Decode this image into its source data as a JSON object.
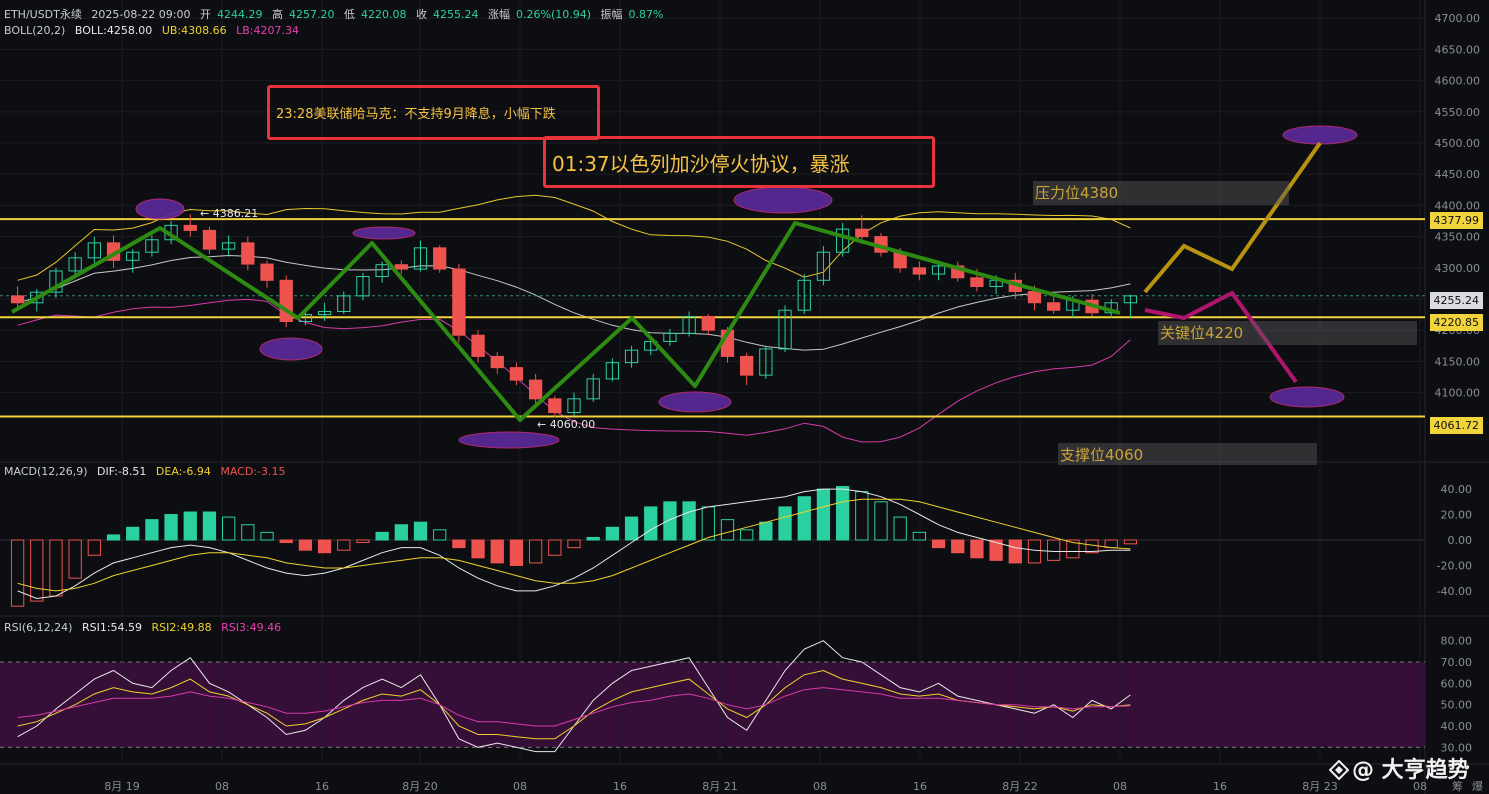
{
  "header": {
    "symbol": "ETH/USDT永续",
    "datetime": "2025-08-22 09:00",
    "open_label": "开",
    "open": "4244.29",
    "high_label": "高",
    "high": "4257.20",
    "low_label": "低",
    "low": "4220.08",
    "close_label": "收",
    "close": "4255.24",
    "chg_label": "涨幅",
    "chg": "0.26%(10.94)",
    "amp_label": "振幅",
    "amp": "0.87%"
  },
  "boll": {
    "name": "BOLL(20,2)",
    "boll": "BOLL:4258.00",
    "ub": "UB:4308.66",
    "lb": "LB:4207.34"
  },
  "macd": {
    "name": "MACD(12,26,9)",
    "dif": "DIF:-8.51",
    "dea": "DEA:-6.94",
    "macd": "MACD:-3.15"
  },
  "rsi": {
    "name": "RSI(6,12,24)",
    "rsi1": "RSI1:54.59",
    "rsi2": "RSI2:49.88",
    "rsi3": "RSI3:49.46"
  },
  "annotations": {
    "note1": "23:28美联储哈马克：不支持9月降息，小幅下跌",
    "note2": "01:37以色列加沙停火协议，暴涨"
  },
  "levels": {
    "resistance": "压力位4380",
    "key": "关键位4220",
    "support": "支撑位4060"
  },
  "price_tags": {
    "upper": "4377.99",
    "current": "4255.24",
    "key": "4220.85",
    "lower": "4061.72"
  },
  "point_labels": {
    "high": "← 4386.21",
    "low": "← 4060.00"
  },
  "watermark": "@ 大亨趋势",
  "corner_labels": [
    "筹",
    "爆"
  ],
  "colors": {
    "up": "#2bd0a0",
    "down": "#ef5350",
    "level": "#f1d33b",
    "trend": "#2e8b12",
    "bull": "#b8930f",
    "bear": "#b0156e",
    "ellipse": "#5b2a9c"
  },
  "chart_data": [
    {
      "type": "candlestick",
      "title": "ETH/USDT永续",
      "ylim": [
        4000,
        4710
      ],
      "y_ticks": [
        4700,
        4650,
        4600,
        4550,
        4500,
        4450,
        4400,
        4350,
        4300,
        4250,
        4200,
        4150,
        4100
      ],
      "x_ticks": [
        "8月 19",
        "08",
        "16",
        "8月 20",
        "08",
        "16",
        "8月 21",
        "08",
        "16",
        "8月 22",
        "08",
        "16",
        "8月 23",
        "08"
      ],
      "levels": [
        4377.99,
        4220.85,
        4061.72
      ],
      "high_marker": 4386.21,
      "low_marker": 4060.0,
      "candles": [
        [
          4255,
          4270,
          4232,
          4244
        ],
        [
          4244,
          4266,
          4230,
          4261
        ],
        [
          4261,
          4300,
          4252,
          4295
        ],
        [
          4295,
          4325,
          4285,
          4316
        ],
        [
          4316,
          4350,
          4308,
          4340
        ],
        [
          4340,
          4352,
          4300,
          4312
        ],
        [
          4312,
          4330,
          4292,
          4325
        ],
        [
          4325,
          4352,
          4318,
          4345
        ],
        [
          4345,
          4375,
          4338,
          4368
        ],
        [
          4368,
          4386,
          4350,
          4360
        ],
        [
          4360,
          4366,
          4322,
          4330
        ],
        [
          4330,
          4352,
          4318,
          4340
        ],
        [
          4340,
          4350,
          4296,
          4306
        ],
        [
          4306,
          4312,
          4268,
          4280
        ],
        [
          4280,
          4288,
          4205,
          4214
        ],
        [
          4214,
          4230,
          4208,
          4225
        ],
        [
          4225,
          4244,
          4215,
          4230
        ],
        [
          4230,
          4262,
          4226,
          4255
        ],
        [
          4255,
          4292,
          4248,
          4286
        ],
        [
          4286,
          4310,
          4276,
          4305
        ],
        [
          4305,
          4312,
          4290,
          4298
        ],
        [
          4298,
          4344,
          4294,
          4332
        ],
        [
          4332,
          4336,
          4292,
          4298
        ],
        [
          4298,
          4306,
          4180,
          4192
        ],
        [
          4192,
          4200,
          4148,
          4158
        ],
        [
          4158,
          4165,
          4130,
          4140
        ],
        [
          4140,
          4148,
          4112,
          4120
        ],
        [
          4120,
          4130,
          4080,
          4090
        ],
        [
          4090,
          4095,
          4060,
          4068
        ],
        [
          4068,
          4100,
          4063,
          4090
        ],
        [
          4090,
          4130,
          4085,
          4122
        ],
        [
          4122,
          4155,
          4118,
          4148
        ],
        [
          4148,
          4175,
          4140,
          4168
        ],
        [
          4168,
          4190,
          4160,
          4182
        ],
        [
          4182,
          4202,
          4175,
          4195
        ],
        [
          4195,
          4230,
          4190,
          4222
        ],
        [
          4222,
          4226,
          4192,
          4200
        ],
        [
          4200,
          4205,
          4148,
          4158
        ],
        [
          4158,
          4164,
          4112,
          4128
        ],
        [
          4128,
          4175,
          4122,
          4170
        ],
        [
          4170,
          4240,
          4165,
          4232
        ],
        [
          4232,
          4290,
          4226,
          4280
        ],
        [
          4280,
          4335,
          4272,
          4325
        ],
        [
          4325,
          4372,
          4318,
          4362
        ],
        [
          4362,
          4384,
          4338,
          4350
        ],
        [
          4350,
          4356,
          4318,
          4325
        ],
        [
          4325,
          4332,
          4292,
          4300
        ],
        [
          4300,
          4310,
          4280,
          4290
        ],
        [
          4290,
          4312,
          4280,
          4303
        ],
        [
          4303,
          4310,
          4278,
          4284
        ],
        [
          4284,
          4298,
          4262,
          4270
        ],
        [
          4270,
          4288,
          4258,
          4280
        ],
        [
          4280,
          4292,
          4250,
          4262
        ],
        [
          4262,
          4272,
          4232,
          4244
        ],
        [
          4244,
          4262,
          4226,
          4232
        ],
        [
          4232,
          4255,
          4220,
          4248
        ],
        [
          4248,
          4258,
          4222,
          4228
        ],
        [
          4228,
          4250,
          4220,
          4244
        ],
        [
          4244,
          4257,
          4220,
          4255
        ]
      ]
    },
    {
      "type": "bar",
      "title": "MACD(12,26,9)",
      "ylim": [
        -55,
        55
      ],
      "y_ticks": [
        40,
        20,
        0,
        -20,
        -40
      ],
      "values": [
        -52,
        -48,
        -44,
        -30,
        -12,
        4,
        10,
        16,
        20,
        22,
        22,
        18,
        12,
        6,
        -2,
        -8,
        -10,
        -8,
        -2,
        6,
        12,
        14,
        8,
        -6,
        -14,
        -18,
        -20,
        -18,
        -12,
        -6,
        2,
        10,
        18,
        26,
        30,
        30,
        26,
        16,
        8,
        14,
        26,
        34,
        40,
        42,
        38,
        30,
        18,
        6,
        -6,
        -10,
        -14,
        -16,
        -18,
        -18,
        -16,
        -14,
        -10,
        -6,
        -3
      ],
      "series": [
        {
          "name": "DIF",
          "values": [
            -40,
            -46,
            -44,
            -36,
            -26,
            -18,
            -14,
            -10,
            -6,
            -4,
            -6,
            -10,
            -16,
            -22,
            -26,
            -28,
            -26,
            -22,
            -16,
            -10,
            -6,
            -6,
            -12,
            -22,
            -30,
            -36,
            -40,
            -40,
            -36,
            -30,
            -22,
            -12,
            -2,
            8,
            16,
            22,
            26,
            28,
            30,
            32,
            34,
            38,
            40,
            40,
            38,
            34,
            28,
            20,
            12,
            6,
            2,
            -2,
            -6,
            -8,
            -9,
            -9,
            -9,
            -8,
            -8
          ]
        },
        {
          "name": "DEA",
          "values": [
            -34,
            -38,
            -40,
            -38,
            -34,
            -28,
            -24,
            -20,
            -16,
            -12,
            -10,
            -10,
            -12,
            -14,
            -18,
            -20,
            -22,
            -22,
            -20,
            -18,
            -16,
            -14,
            -14,
            -16,
            -20,
            -24,
            -28,
            -32,
            -34,
            -34,
            -32,
            -28,
            -22,
            -16,
            -10,
            -4,
            2,
            6,
            10,
            14,
            18,
            22,
            26,
            30,
            32,
            32,
            32,
            30,
            26,
            22,
            18,
            14,
            10,
            6,
            2,
            -2,
            -4,
            -6,
            -7
          ]
        }
      ]
    },
    {
      "type": "line",
      "title": "RSI(6,12,24)",
      "ylim": [
        25,
        85
      ],
      "y_ticks": [
        80,
        70,
        60,
        50,
        40,
        30
      ],
      "series": [
        {
          "name": "RSI1",
          "values": [
            35,
            40,
            48,
            55,
            62,
            66,
            60,
            58,
            66,
            72,
            60,
            56,
            50,
            44,
            36,
            38,
            44,
            52,
            58,
            62,
            58,
            64,
            50,
            34,
            30,
            32,
            30,
            28,
            28,
            40,
            52,
            60,
            66,
            68,
            70,
            72,
            58,
            44,
            38,
            52,
            66,
            76,
            80,
            72,
            70,
            64,
            58,
            56,
            60,
            54,
            52,
            50,
            48,
            46,
            50,
            44,
            52,
            48,
            54.59
          ]
        },
        {
          "name": "RSI2",
          "values": [
            40,
            42,
            46,
            50,
            55,
            58,
            56,
            55,
            58,
            62,
            56,
            54,
            50,
            46,
            40,
            41,
            44,
            48,
            52,
            55,
            54,
            57,
            50,
            40,
            36,
            36,
            35,
            34,
            34,
            40,
            47,
            52,
            56,
            58,
            60,
            62,
            55,
            48,
            44,
            50,
            58,
            64,
            66,
            62,
            60,
            58,
            55,
            54,
            55,
            52,
            51,
            50,
            49,
            48,
            49,
            47,
            50,
            49,
            49.88
          ]
        },
        {
          "name": "RSI3",
          "values": [
            44,
            45,
            47,
            49,
            51,
            53,
            53,
            53,
            54,
            56,
            54,
            53,
            51,
            49,
            46,
            46,
            47,
            49,
            51,
            52,
            52,
            53,
            50,
            45,
            42,
            42,
            41,
            40,
            40,
            43,
            46,
            49,
            51,
            52,
            54,
            55,
            53,
            50,
            48,
            50,
            54,
            57,
            58,
            57,
            56,
            55,
            53,
            53,
            53,
            52,
            51,
            50,
            50,
            49,
            49,
            48,
            49,
            49,
            49.46
          ]
        }
      ]
    }
  ]
}
